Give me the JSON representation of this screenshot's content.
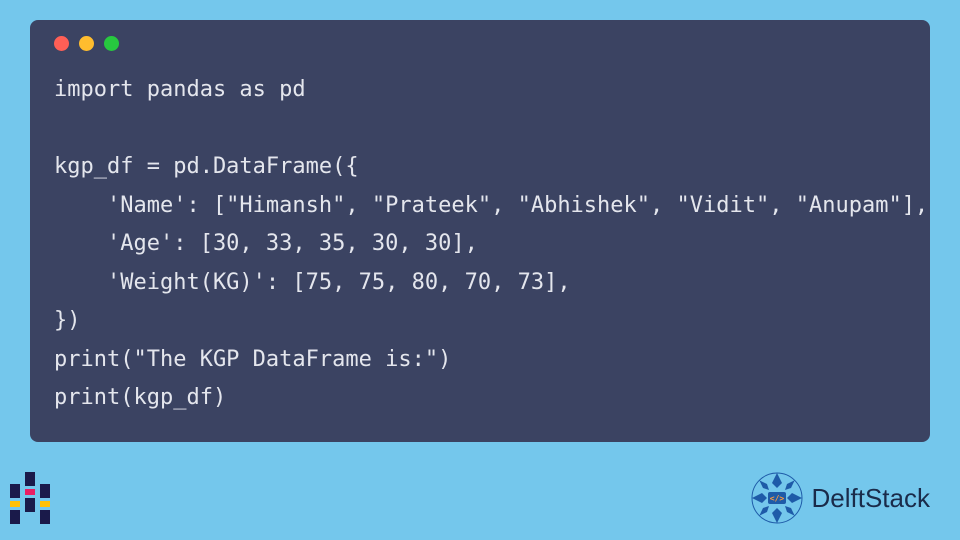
{
  "code": {
    "line1": "import pandas as pd",
    "line2": "",
    "line3": "kgp_df = pd.DataFrame({",
    "line4": "    'Name': [\"Himansh\", \"Prateek\", \"Abhishek\", \"Vidit\", \"Anupam\"],",
    "line5": "    'Age': [30, 33, 35, 30, 30],",
    "line6": "    'Weight(KG)': [75, 75, 80, 70, 73],",
    "line7": "})",
    "line8": "print(\"The KGP DataFrame is:\")",
    "line9": "print(kgp_df)"
  },
  "brand": "DelftStack",
  "colors": {
    "bg": "#74c7ec",
    "window": "#3b4362",
    "text": "#e4e6ed",
    "red": "#ff5f56",
    "yellow": "#ffbd2e",
    "green": "#27c93f",
    "brand_blue": "#1e5ba8",
    "brand_accent": "#ff6b35"
  }
}
